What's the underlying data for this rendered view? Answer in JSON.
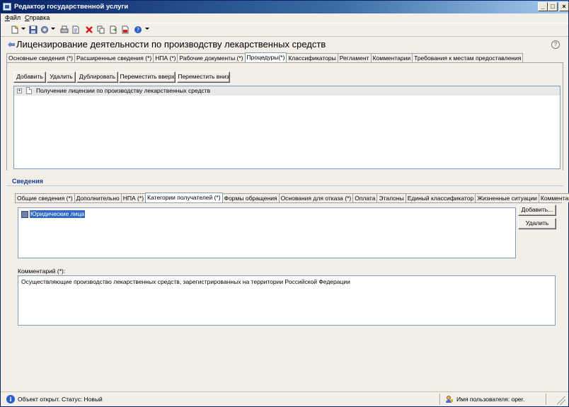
{
  "window": {
    "title": "Редактор государственной услуги"
  },
  "menu": {
    "items": [
      "Файл",
      "Справка"
    ]
  },
  "toolbar": {
    "icons": [
      "new-document-icon",
      "save-icon",
      "settings-icon",
      "print-icon",
      "preview-icon",
      "delete-icon",
      "copy-icon",
      "export-icon",
      "pdf-icon",
      "help-icon"
    ]
  },
  "page": {
    "title": "Лицензирование деятельности по производству лекарственных средств"
  },
  "top_tabs": [
    {
      "label": "Основные сведения (*)"
    },
    {
      "label": "Расширенные сведения (*)"
    },
    {
      "label": "НПА (*)"
    },
    {
      "label": "Рабочие документы (*)"
    },
    {
      "label": "Процедуры(*)",
      "active": true
    },
    {
      "label": "Классификаторы"
    },
    {
      "label": "Регламент"
    },
    {
      "label": "Комментарии"
    },
    {
      "label": "Требования к местам предоставления"
    }
  ],
  "procedures": {
    "buttons": {
      "add": "Добавить",
      "remove": "Удалить",
      "duplicate": "Дублировать",
      "move_up": "Переместить вверх",
      "move_down": "Переместить вниз"
    },
    "tree_item": "Получение лицензии по производству лекарственных средств"
  },
  "details": {
    "section_title": "Сведения",
    "tabs": [
      {
        "label": "Общие сведения (*)"
      },
      {
        "label": "Дополнительно"
      },
      {
        "label": "НПА (*)"
      },
      {
        "label": "Категории получателей (*)",
        "active": true
      },
      {
        "label": "Формы обращения"
      },
      {
        "label": "Основания для отказа (*)"
      },
      {
        "label": "Оплата"
      },
      {
        "label": "Эталоны"
      },
      {
        "label": "Единый классификатор"
      },
      {
        "label": "Жизненные ситуации"
      },
      {
        "label": "Комментарии"
      }
    ],
    "recipients": [
      "Юридические лица"
    ],
    "add_button": "Добавить...",
    "remove_button": "Удалить",
    "comment_label": "Комментарий (*):",
    "comment_value": "Осуществляющие производство лекарственных средств, зарегистрированных на территории Российской Федерации"
  },
  "status": {
    "object_text": "Объект открыт. Статус: Новый",
    "user_text": "Имя пользователя: oper."
  },
  "colors": {
    "titlebar_start": "#0a246a",
    "titlebar_end": "#a6caf0",
    "selection": "#316ac5",
    "section_title": "#1a3d8f"
  }
}
